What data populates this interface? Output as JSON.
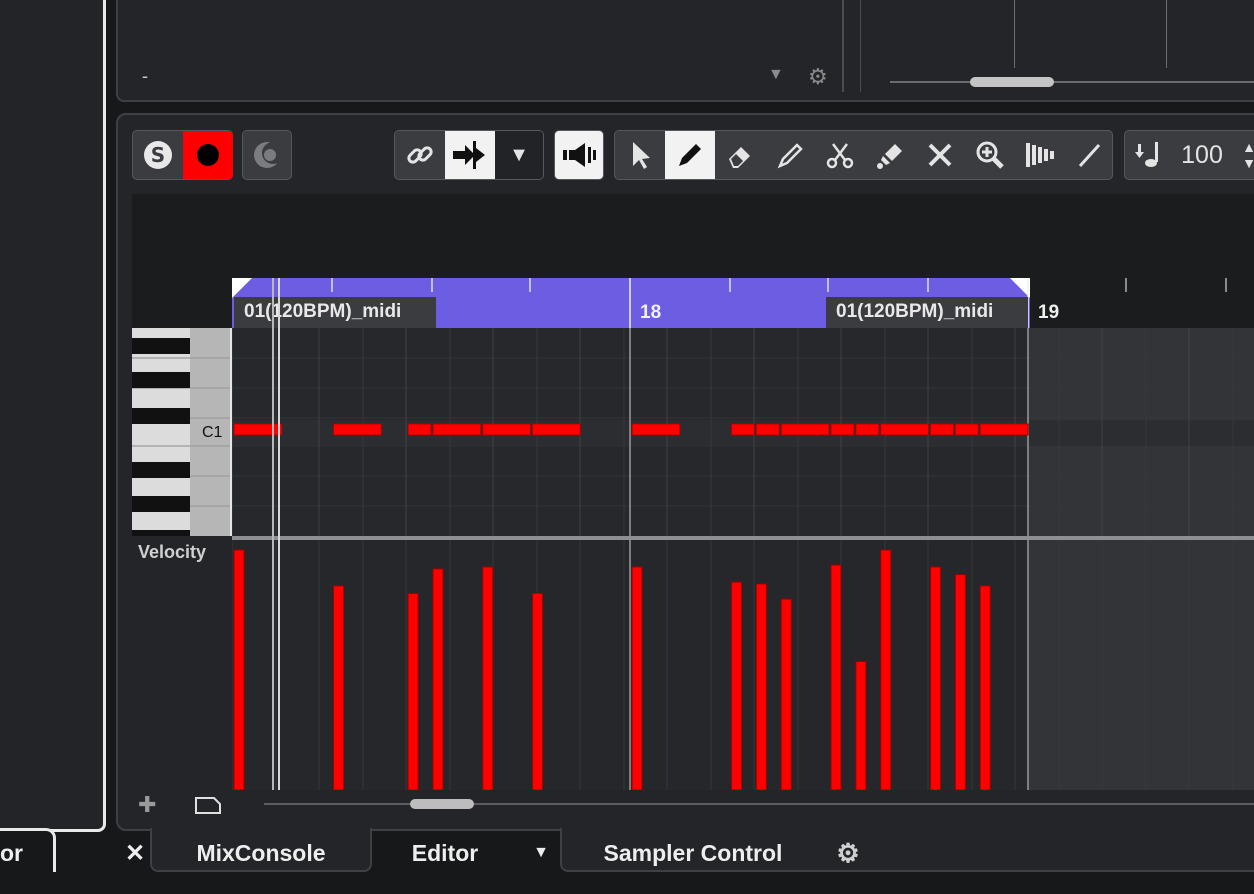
{
  "top_panel": {
    "dash": "-",
    "dropdown_icon": "caret-down-icon",
    "settings_icon": "gear-icon"
  },
  "toolbar": {
    "solo_icon": "solo-s-icon",
    "record_icon": "record-icon",
    "moon_icon": "moon-icon",
    "link_icon": "link-icon",
    "insert_icon": "insert-velocity-icon",
    "menu_icon": "caret-down-icon",
    "speaker_icon": "speaker-icon",
    "tools": [
      "object-selection-icon",
      "draw-icon",
      "erase-icon",
      "trim-icon",
      "split-icon",
      "glue-icon",
      "mute-icon",
      "zoom-icon",
      "line-icon",
      "comp-icon"
    ],
    "insert_velocity_value": "100"
  },
  "ruler": {
    "part_name": "01(120BPM)_midi",
    "bars": [
      "18",
      "19"
    ]
  },
  "piano": {
    "c1_label": "C1"
  },
  "velocity": {
    "label": "Velocity"
  },
  "bottom": {
    "add_icon": "add-lane-icon",
    "preset_icon": "lane-presets-icon"
  },
  "tabs": {
    "left_fragment": "or",
    "close_icon": "close-icon",
    "mixconsole": "MixConsole",
    "editor": "Editor",
    "sampler": "Sampler Control",
    "settings_icon": "gear-icon"
  },
  "colors": {
    "note": "#ff0000",
    "part": "#6c5de3",
    "record": "#ff0000",
    "background": "#232528"
  },
  "notes": [
    {
      "start": 0.0,
      "length": 0.5
    },
    {
      "start": 1.0,
      "length": 0.5
    },
    {
      "start": 1.75,
      "length": 0.25
    },
    {
      "start": 2.0,
      "length": 0.5
    },
    {
      "start": 2.5,
      "length": 0.5
    },
    {
      "start": 3.0,
      "length": 0.5
    },
    {
      "start": 4.0,
      "length": 0.5
    },
    {
      "start": 5.0,
      "length": 0.25
    },
    {
      "start": 5.25,
      "length": 0.25
    },
    {
      "start": 5.5,
      "length": 0.5
    },
    {
      "start": 6.0,
      "length": 0.25
    },
    {
      "start": 6.25,
      "length": 0.25
    },
    {
      "start": 6.5,
      "length": 0.5
    },
    {
      "start": 7.0,
      "length": 0.25
    },
    {
      "start": 7.25,
      "length": 0.25
    },
    {
      "start": 7.5,
      "length": 0.5
    }
  ],
  "velocities": [
    {
      "pos": 0.0,
      "value": 127
    },
    {
      "pos": 1.0,
      "value": 108
    },
    {
      "pos": 1.75,
      "value": 104
    },
    {
      "pos": 2.0,
      "value": 117
    },
    {
      "pos": 2.5,
      "value": 118
    },
    {
      "pos": 3.0,
      "value": 104
    },
    {
      "pos": 4.0,
      "value": 118
    },
    {
      "pos": 5.0,
      "value": 110
    },
    {
      "pos": 5.25,
      "value": 109
    },
    {
      "pos": 5.5,
      "value": 101
    },
    {
      "pos": 6.0,
      "value": 119
    },
    {
      "pos": 6.25,
      "value": 68
    },
    {
      "pos": 6.5,
      "value": 127
    },
    {
      "pos": 7.0,
      "value": 118
    },
    {
      "pos": 7.25,
      "value": 114
    },
    {
      "pos": 7.5,
      "value": 108
    }
  ]
}
